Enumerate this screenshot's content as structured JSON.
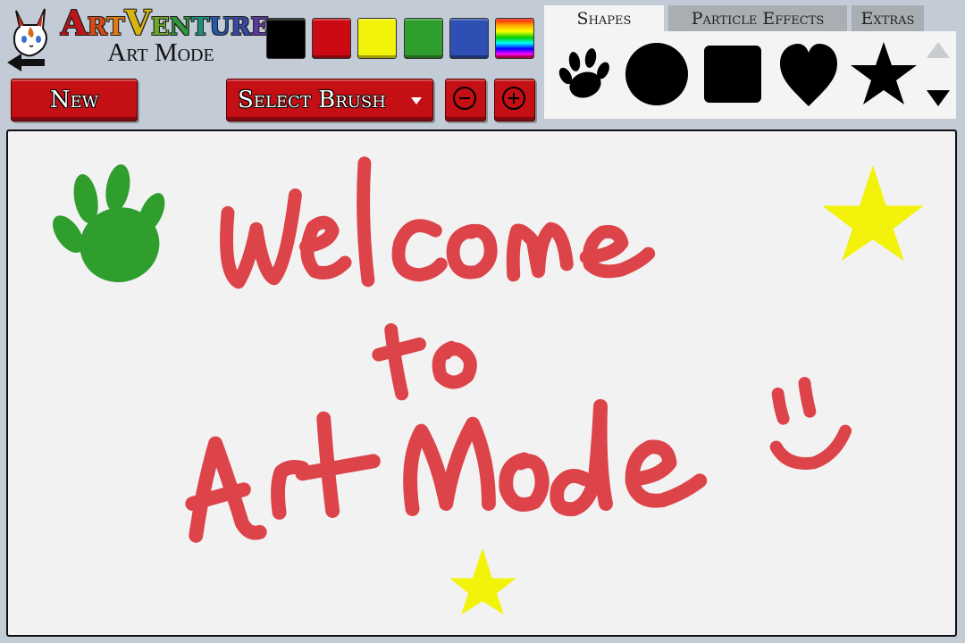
{
  "app": {
    "title_segments": [
      {
        "text": "A",
        "color": "#c0141b"
      },
      {
        "text": "r",
        "color": "#d94a14"
      },
      {
        "text": "t",
        "color": "#e07a12"
      },
      {
        "text": "V",
        "color": "#d7b40f"
      },
      {
        "text": "e",
        "color": "#6da82a"
      },
      {
        "text": "n",
        "color": "#2f9a3a"
      },
      {
        "text": "t",
        "color": "#1f8e7a"
      },
      {
        "text": "u",
        "color": "#2658b0"
      },
      {
        "text": "r",
        "color": "#3848a6"
      },
      {
        "text": "e",
        "color": "#5b3aa0"
      }
    ],
    "subtitle": "Art Mode"
  },
  "palette": {
    "swatches": [
      {
        "name": "black",
        "color": "#000000"
      },
      {
        "name": "red",
        "color": "#cc0a14"
      },
      {
        "name": "yellow",
        "color": "#f3f30a"
      },
      {
        "name": "green",
        "color": "#2f9e2d"
      },
      {
        "name": "blue",
        "color": "#2e4fb3"
      },
      {
        "name": "rainbow",
        "color": "rainbow"
      }
    ]
  },
  "toolbar": {
    "new_label": "New",
    "select_brush_label": "Select Brush"
  },
  "tabs": [
    {
      "label": "Shapes",
      "active": true
    },
    {
      "label": "Particle Effects",
      "active": false
    },
    {
      "label": "Extras",
      "active": false
    }
  ],
  "shapes": [
    "paw-print",
    "circle",
    "rounded-square",
    "heart",
    "star"
  ],
  "canvas": {
    "drawing": "Welcome to Art Mode, with a green paw print, two yellow stars and a smiley face",
    "text_lines": [
      "Welcome",
      "to",
      "Art Mode"
    ],
    "colors": {
      "text": "#d9262c",
      "paw": "#2f9e2d",
      "stars": "#f2f20a"
    }
  }
}
